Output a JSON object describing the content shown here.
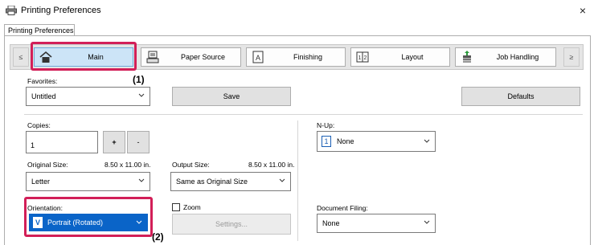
{
  "window": {
    "title": "Printing Preferences",
    "close_glyph": "×",
    "icon": "printer-icon"
  },
  "tabs": [
    {
      "label": "Printing Preferences"
    }
  ],
  "ribbon": {
    "prev_glyph": "≤",
    "next_glyph": "≥",
    "items": [
      {
        "label": "Main",
        "icon": "home-icon"
      },
      {
        "label": "Paper Source",
        "icon": "paper-tray-icon"
      },
      {
        "label": "Finishing",
        "icon": "finishing-icon"
      },
      {
        "label": "Layout",
        "icon": "layout-icon"
      },
      {
        "label": "Job Handling",
        "icon": "job-handling-icon"
      }
    ]
  },
  "callouts": {
    "one": "(1)",
    "two": "(2)"
  },
  "favorites": {
    "label": "Favorites:",
    "value": "Untitled",
    "save_label": "Save",
    "defaults_label": "Defaults"
  },
  "copies": {
    "label": "Copies:",
    "value": "1",
    "plus": "+",
    "minus": "-"
  },
  "nup": {
    "label": "N-Up:",
    "badge": "1",
    "value": "None"
  },
  "original_size": {
    "label": "Original Size:",
    "dims": "8.50 x 11.00 in.",
    "value": "Letter"
  },
  "output_size": {
    "label": "Output Size:",
    "dims": "8.50 x 11.00 in.",
    "value": "Same as Original Size"
  },
  "orientation": {
    "label": "Orientation:",
    "value": "Portrait (Rotated)",
    "icon_letter": "V"
  },
  "zoom": {
    "label": "Zoom",
    "settings_label": "Settings..."
  },
  "document_filing": {
    "label": "Document Filing:",
    "value": "None"
  }
}
